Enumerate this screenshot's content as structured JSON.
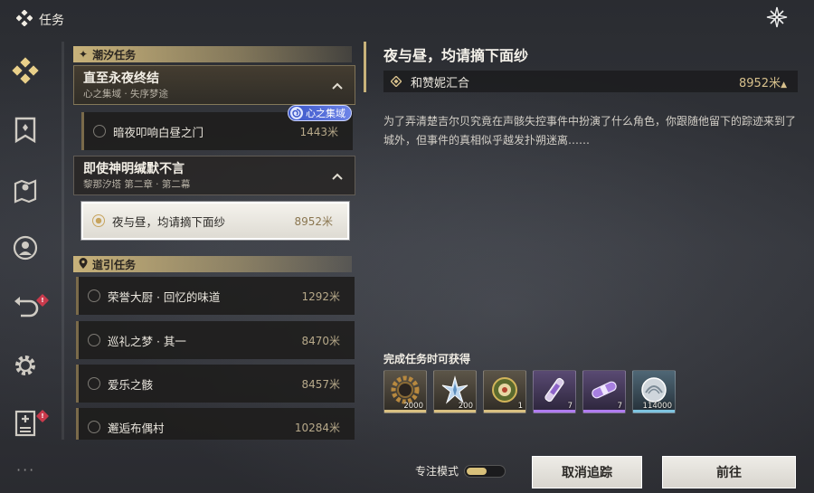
{
  "header": {
    "title": "任务"
  },
  "nav": [
    {
      "name": "nav-quest-icon",
      "badge": ""
    },
    {
      "name": "nav-bookmark-icon",
      "badge": ""
    },
    {
      "name": "nav-map-icon",
      "badge": ""
    },
    {
      "name": "nav-companion-icon",
      "badge": ""
    },
    {
      "name": "nav-return-icon",
      "badge": "!"
    },
    {
      "name": "nav-settings-icon",
      "badge": ""
    },
    {
      "name": "nav-archive-icon",
      "badge": "!"
    }
  ],
  "nav_more": "···",
  "list": {
    "section_tide": "潮汐任务",
    "section_guide": "道引任务",
    "groups": [
      {
        "title": "直至永夜终结",
        "subtitle": "心之集域 · 失序梦途"
      },
      {
        "title": "即使神明缄默不言",
        "subtitle": "黎那汐塔 第二章 · 第二幕"
      }
    ],
    "tag_badge": "心之集域",
    "quests": [
      {
        "name": "暗夜叩响白昼之门",
        "distance": "1443米"
      },
      {
        "name": "夜与昼，均请摘下面纱",
        "distance": "8952米"
      },
      {
        "name": "荣誉大厨 · 回忆的味道",
        "distance": "1292米"
      },
      {
        "name": "巡礼之梦 · 其一",
        "distance": "8470米"
      },
      {
        "name": "爱乐之骸",
        "distance": "8457米"
      },
      {
        "name": "邂逅布偶村",
        "distance": "10284米"
      }
    ]
  },
  "detail": {
    "title": "夜与昼，均请摘下面纱",
    "objective": "和赞妮汇合",
    "objective_distance": "8952米",
    "objective_arrow": "▲",
    "description": "为了弄清楚吉尔贝究竟在声骸失控事件中扮演了什么角色，你跟随他留下的踪迹来到了城外，但事件的真相似乎越发扑朔迷离……",
    "reward_label": "完成任务时可获得",
    "rewards": [
      {
        "icon": "gear-coin-icon",
        "count": "2000",
        "rarity_color": "#d9c081"
      },
      {
        "icon": "crystal-star-icon",
        "count": "200",
        "rarity_color": "#d9c081"
      },
      {
        "icon": "seal-orb-icon",
        "count": "1",
        "rarity_color": "#d9c081"
      },
      {
        "icon": "energy-tube-icon",
        "count": "7",
        "rarity_color": "#b07cf0"
      },
      {
        "icon": "capsule-icon",
        "count": "7",
        "rarity_color": "#b07cf0"
      },
      {
        "icon": "shell-coin-icon",
        "count": "114000",
        "rarity_color": "#7ec4e0"
      }
    ]
  },
  "footer": {
    "focus_label": "专注模式",
    "cancel_label": "取消追踪",
    "go_label": "前往"
  },
  "colors": {
    "accent_gold": "#c8b27a",
    "badge_red": "#c93a4c",
    "badge_blue": "#4a64d6"
  }
}
